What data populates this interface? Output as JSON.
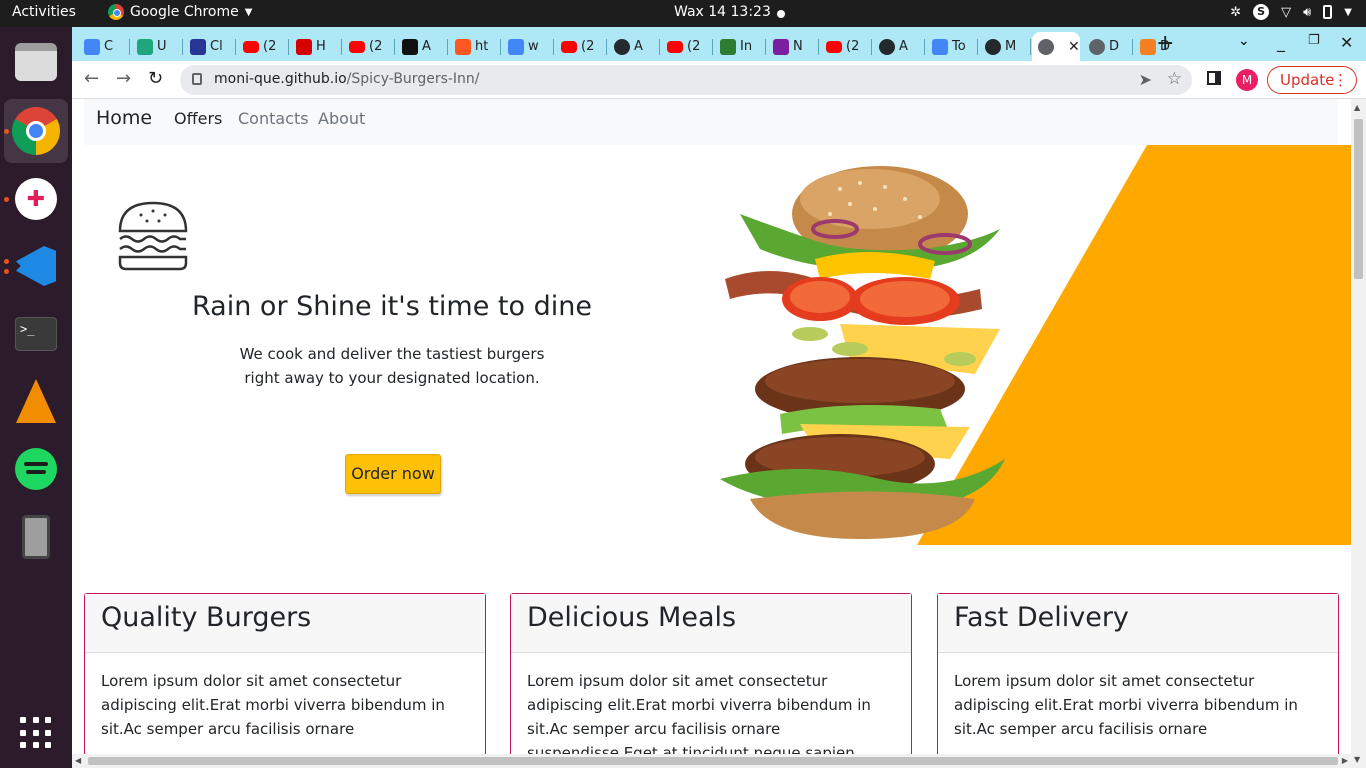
{
  "os": {
    "activities": "Activities",
    "app_name": "Google Chrome",
    "clock": "Wax 14  13:23"
  },
  "browser": {
    "tabs": [
      {
        "label": "C",
        "icon": "docs-icon",
        "color": "#4285f4"
      },
      {
        "label": "U",
        "icon": "brand-icon",
        "color": "#1fa67a"
      },
      {
        "label": "Cl",
        "icon": "brand-icon",
        "color": "#283593"
      },
      {
        "label": "(2",
        "icon": "youtube-icon",
        "color": "#ff0000"
      },
      {
        "label": "H",
        "icon": "brand-icon",
        "color": "#d50000"
      },
      {
        "label": "(2",
        "icon": "youtube-icon",
        "color": "#ff0000"
      },
      {
        "label": "A",
        "icon": "brand-icon",
        "color": "#111111"
      },
      {
        "label": "ht",
        "icon": "brand-icon",
        "color": "#ff5722"
      },
      {
        "label": "w",
        "icon": "google-icon",
        "color": "#4285f4"
      },
      {
        "label": "(2",
        "icon": "youtube-icon",
        "color": "#ff0000"
      },
      {
        "label": "A",
        "icon": "github-icon",
        "color": "#24292e"
      },
      {
        "label": "(2",
        "icon": "youtube-icon",
        "color": "#ff0000"
      },
      {
        "label": "In",
        "icon": "brand-icon",
        "color": "#2e7d32"
      },
      {
        "label": "N",
        "icon": "brand-icon",
        "color": "#7b1fa2"
      },
      {
        "label": "(2",
        "icon": "youtube-icon",
        "color": "#ff0000"
      },
      {
        "label": "A",
        "icon": "github-icon",
        "color": "#24292e"
      },
      {
        "label": "To",
        "icon": "google-icon",
        "color": "#4285f4"
      },
      {
        "label": "M",
        "icon": "github-icon",
        "color": "#24292e"
      },
      {
        "label": "",
        "icon": "globe-icon",
        "color": "#5f6368"
      },
      {
        "label": "D",
        "icon": "globe-icon",
        "color": "#5f6368"
      },
      {
        "label": "D",
        "icon": "brand-icon",
        "color": "#f48024"
      }
    ],
    "active_tab_index": 18,
    "url_host": "moni-que.github.io",
    "url_path": "/Spicy-Burgers-Inn/",
    "avatar_letter": "M",
    "update_label": "Update"
  },
  "site": {
    "brand": "Home",
    "nav": [
      "Offers",
      "Contacts",
      "About"
    ],
    "hero": {
      "title": "Rain or Shine it's time to dine",
      "subtitle_line1": "We cook and deliver the tastiest burgers",
      "subtitle_line2": "right away to your designated location.",
      "button": "Order now"
    },
    "cards": [
      {
        "title": "Quality Burgers",
        "text": "Lorem ipsum dolor sit amet consectetur adipiscing elit.Erat morbi viverra bibendum in sit.Ac semper arcu facilisis ornare"
      },
      {
        "title": "Delicious Meals",
        "text": "Lorem ipsum dolor sit amet consectetur adipiscing elit.Erat morbi viverra bibendum in sit.Ac semper arcu facilisis ornare suspendisse.Eget at tincidunt neque sapien enim tristique eu"
      },
      {
        "title": "Fast Delivery",
        "text": "Lorem ipsum dolor sit amet consectetur adipiscing elit.Erat morbi viverra bibendum in sit.Ac semper arcu facilisis ornare"
      }
    ],
    "accent_color": "#ffa800",
    "button_color": "#ffc107",
    "card_border_color": "#c2185b"
  }
}
